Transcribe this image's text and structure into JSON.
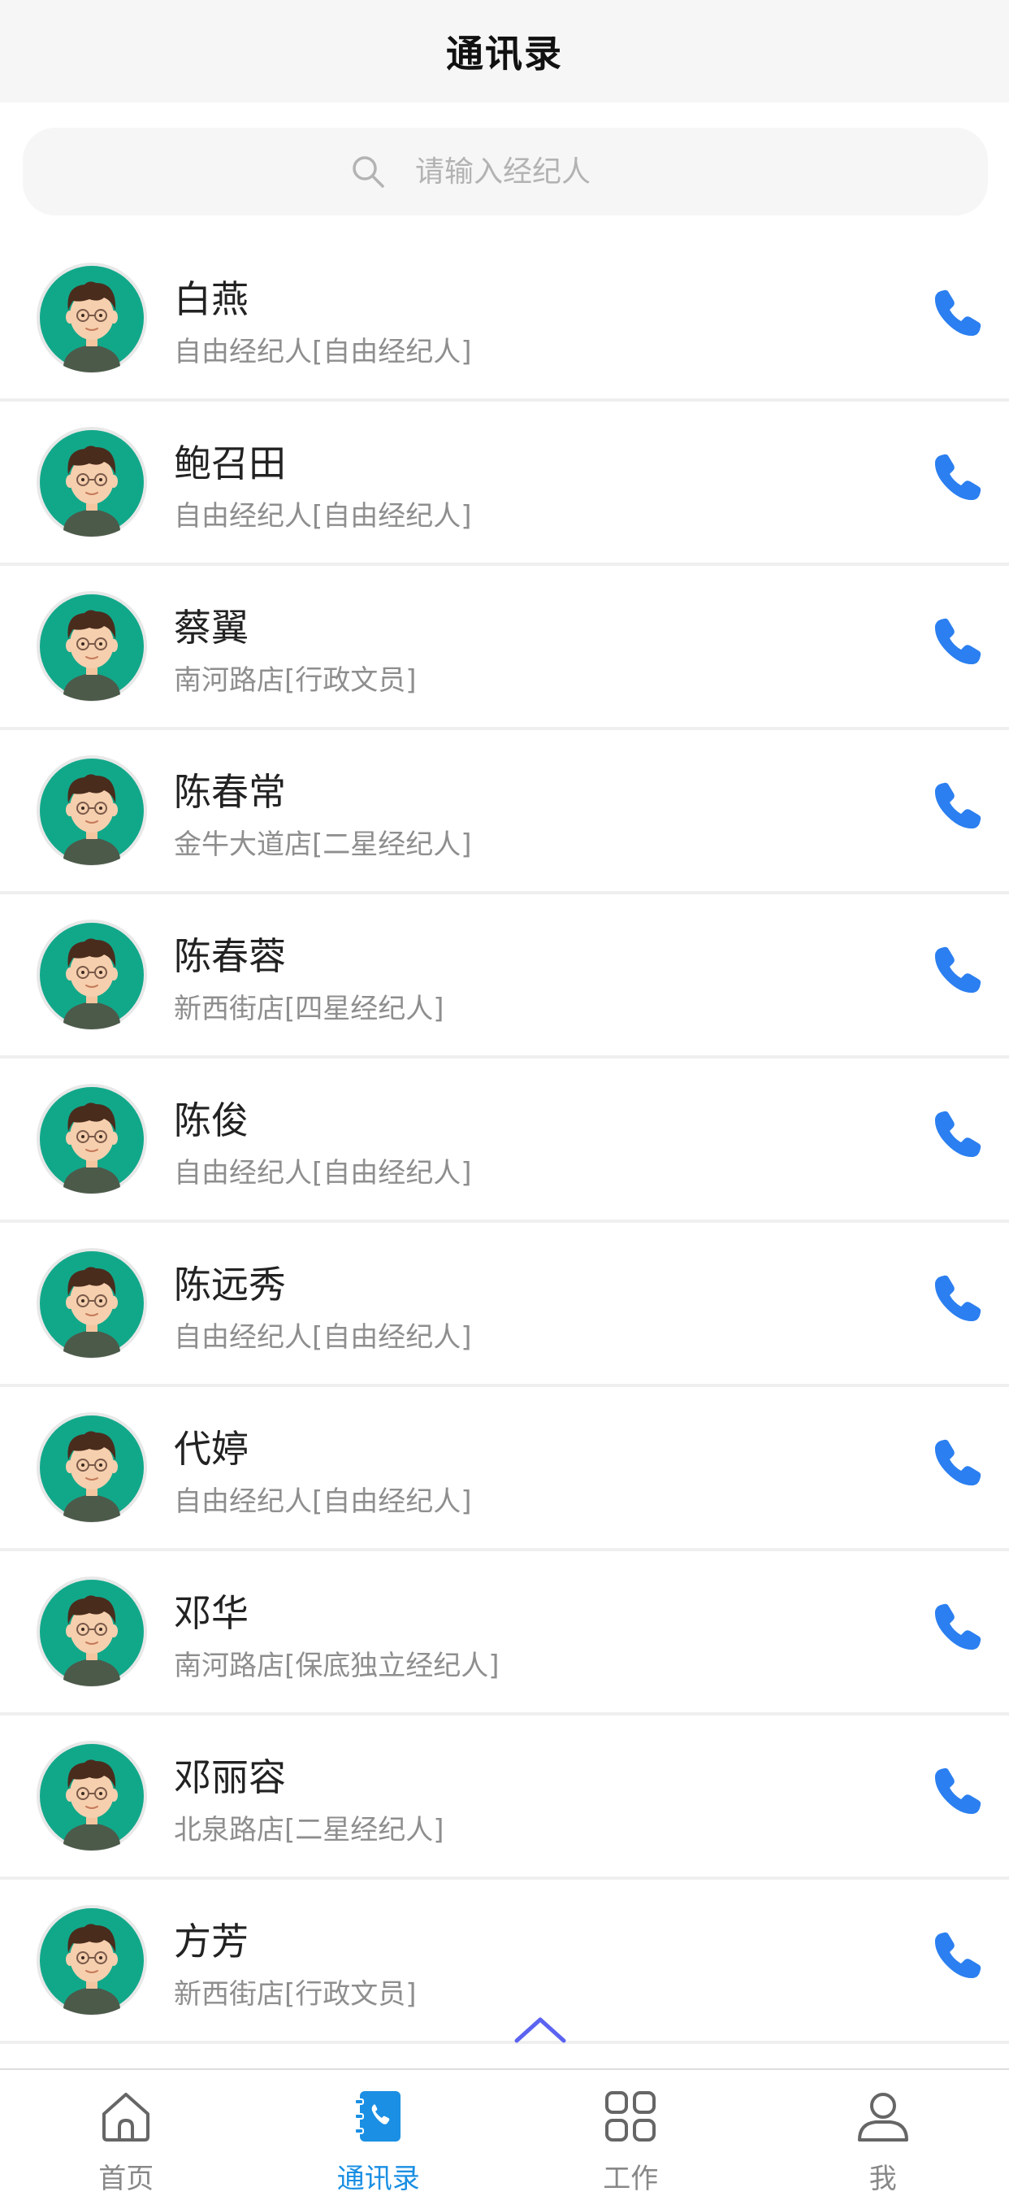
{
  "header": {
    "title": "通讯录"
  },
  "search": {
    "placeholder": "请输入经纪人"
  },
  "contacts": [
    {
      "name": "白燕",
      "subtitle": "自由经纪人[自由经纪人]"
    },
    {
      "name": "鲍召田",
      "subtitle": "自由经纪人[自由经纪人]"
    },
    {
      "name": "蔡翼",
      "subtitle": "南河路店[行政文员]"
    },
    {
      "name": "陈春常",
      "subtitle": "金牛大道店[二星经纪人]"
    },
    {
      "name": "陈春蓉",
      "subtitle": "新西街店[四星经纪人]"
    },
    {
      "name": "陈俊",
      "subtitle": "自由经纪人[自由经纪人]"
    },
    {
      "name": "陈远秀",
      "subtitle": "自由经纪人[自由经纪人]"
    },
    {
      "name": "代婷",
      "subtitle": "自由经纪人[自由经纪人]"
    },
    {
      "name": "邓华",
      "subtitle": "南河路店[保底独立经纪人]"
    },
    {
      "name": "邓丽容",
      "subtitle": "北泉路店[二星经纪人]"
    },
    {
      "name": "方芳",
      "subtitle": "新西街店[行政文员]"
    }
  ],
  "tabs": [
    {
      "label": "首页",
      "icon": "home-icon"
    },
    {
      "label": "通讯录",
      "icon": "contacts-icon",
      "active": true
    },
    {
      "label": "工作",
      "icon": "grid-icon"
    },
    {
      "label": "我",
      "icon": "user-icon"
    }
  ],
  "colors": {
    "accent": "#1a8fe3",
    "call": "#2b7ff0",
    "avatar_bg": "#11a88a",
    "header_bg": "#f6f6f6"
  }
}
